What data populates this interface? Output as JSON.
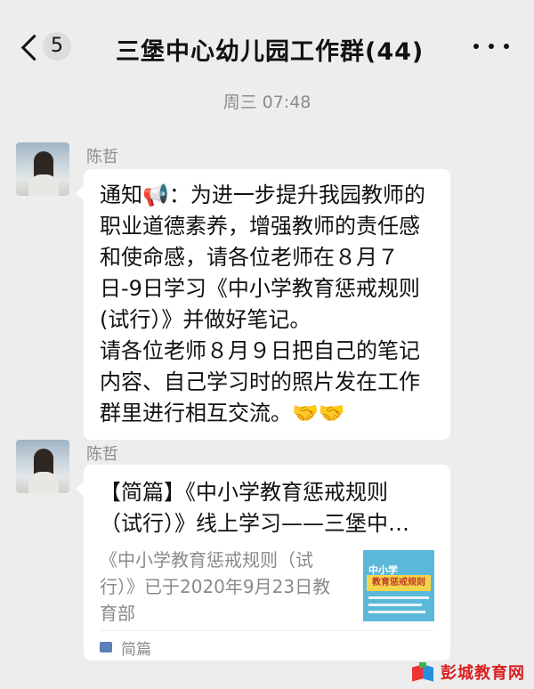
{
  "header": {
    "back_count": "5",
    "title": "三堡中心幼儿园工作群(44)"
  },
  "timestamp": "周三 07:48",
  "messages": [
    {
      "sender": "陈哲",
      "text": "通知📢：为进一步提升我园教师的\n职业道德素养，增强教师的责任感\n和使命感，请各位老师在８月７\n日-9日学习《中小学教育惩戒规则\n(试行）》并做好笔记。\n请各位老师８月９日把自己的笔记\n内容、自己学习时的照片发在工作\n群里进行相互交流。🤝🤝"
    },
    {
      "sender": "陈哲",
      "card": {
        "title": "【简篇】《中小学教育惩戒规则（试行）》线上学习——三堡中…",
        "description": "《中小学教育惩戒规则（试行）》已于2020年9月23日教育部",
        "thumbnail_text": "中小学",
        "thumbnail_banner": "教育惩戒规则",
        "source": "简篇"
      }
    }
  ],
  "watermark": {
    "text": "彭城教育网"
  }
}
